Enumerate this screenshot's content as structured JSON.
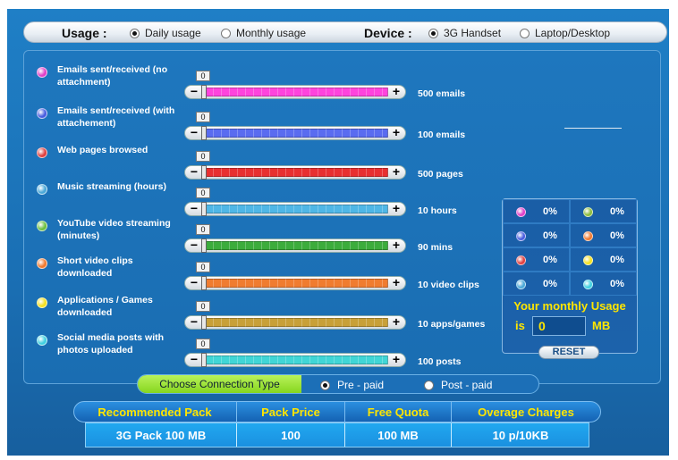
{
  "topbar": {
    "usage_label": "Usage :",
    "usage_options": [
      {
        "label": "Daily usage",
        "selected": true
      },
      {
        "label": "Monthly usage",
        "selected": false
      }
    ],
    "device_label": "Device :",
    "device_options": [
      {
        "label": "3G Handset",
        "selected": true
      },
      {
        "label": "Laptop/Desktop",
        "selected": false
      }
    ]
  },
  "sliders": [
    {
      "label": "Emails sent/received (no attachment)",
      "value": "0",
      "max": "500 emails",
      "color": "#ff44dd",
      "dot": "#e040c8"
    },
    {
      "label": "Emails sent/received (with attachement)",
      "value": "0",
      "max": "100 emails",
      "color": "#5a6cf0",
      "dot": "#4a5ee0"
    },
    {
      "label": "Web pages browsed",
      "value": "0",
      "max": "500 pages",
      "color": "#e83030",
      "dot": "#e04040"
    },
    {
      "label": "Music streaming (hours)",
      "value": "0",
      "max": "10 hours",
      "color": "#4fb7e6",
      "dot": "#4aa8d8"
    },
    {
      "label": "YouTube video streaming (minutes)",
      "value": "0",
      "max": "90 mins",
      "color": "#3cac3c",
      "dot": "#6cc040"
    },
    {
      "label": "Short video clips downloaded",
      "value": "0",
      "max": "10 video clips",
      "color": "#f07c30",
      "dot": "#f07a30"
    },
    {
      "label": "Applications / Games downloaded",
      "value": "0",
      "max": "10 apps/games",
      "color": "#c8a038",
      "dot": "#f4e020"
    },
    {
      "label": "Social media posts with photos uploaded",
      "value": "0",
      "max": "100 posts",
      "color": "#40d6d6",
      "dot": "#40d0e0"
    }
  ],
  "stats": {
    "cells": [
      {
        "color": "#e040c8",
        "pct": "0%"
      },
      {
        "color": "#8cbc3c",
        "pct": "0%"
      },
      {
        "color": "#4a5ee0",
        "pct": "0%"
      },
      {
        "color": "#f07a30",
        "pct": "0%"
      },
      {
        "color": "#e04040",
        "pct": "0%"
      },
      {
        "color": "#f4e020",
        "pct": "0%"
      },
      {
        "color": "#4aa8d8",
        "pct": "0%"
      },
      {
        "color": "#40d0e0",
        "pct": "0%"
      }
    ],
    "title": "Your monthly Usage",
    "is_label": "is",
    "value": "0",
    "unit": "MB",
    "reset_label": "RESET"
  },
  "connection": {
    "label": "Choose Connection Type",
    "options": [
      {
        "label": "Pre - paid",
        "selected": true
      },
      {
        "label": "Post - paid",
        "selected": false
      }
    ]
  },
  "pack": {
    "headers": [
      "Recommended Pack",
      "Pack Price",
      "Free Quota",
      "Overage Charges"
    ],
    "values": [
      "3G Pack 100 MB",
      "100",
      "100 MB",
      "10 p/10KB"
    ]
  }
}
